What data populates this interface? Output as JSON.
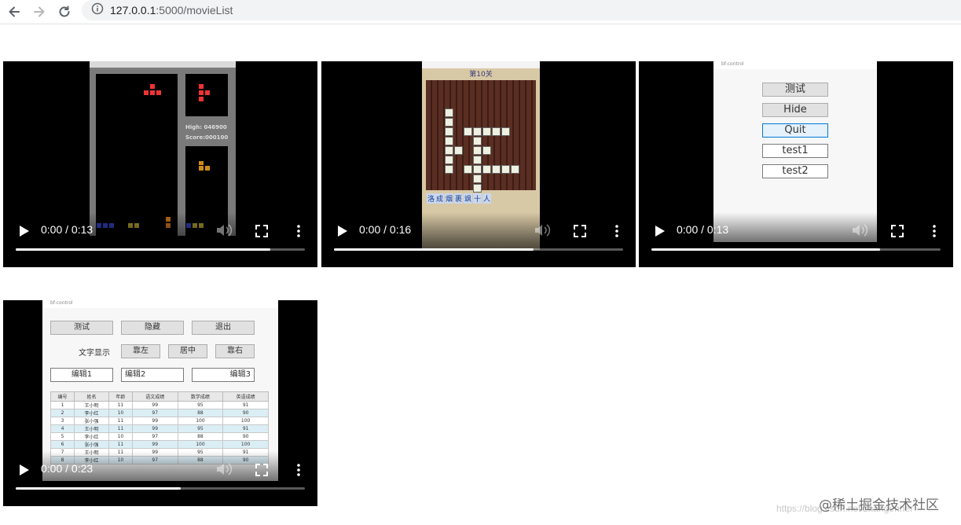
{
  "browser": {
    "url_host": "127.0.0.1",
    "url_path": ":5000/movieList",
    "icons": [
      "back-arrow-icon",
      "forward-arrow-icon",
      "reload-icon",
      "info-icon"
    ]
  },
  "videos": [
    {
      "time": "0:00 / 0:13",
      "progress": 0.88,
      "content": {
        "high": "High: 046900",
        "score": "Score:000100"
      }
    },
    {
      "time": "0:00 / 0:16",
      "progress": 0.69,
      "content": {
        "level": "第10关",
        "options": [
          "洛",
          "成",
          "烟",
          "裹",
          "飒",
          "十",
          "人"
        ]
      }
    },
    {
      "time": "0:00 / 0:13",
      "progress": 0.79,
      "content": {
        "window_title": "bf-control",
        "buttons": [
          "测试",
          "Hide",
          "Quit"
        ],
        "edits": [
          "test1",
          "test2"
        ]
      }
    },
    {
      "time": "0:00 / 0:23",
      "progress": 0.57,
      "content": {
        "window_title": "bf-control",
        "top_buttons": [
          "测试",
          "隐藏",
          "退出"
        ],
        "text_label": "文字显示",
        "align_buttons": [
          "靠左",
          "居中",
          "靠右"
        ],
        "edits": [
          "编辑1",
          "编辑2",
          "编辑3"
        ],
        "table_headers": [
          "编号",
          "姓名",
          "年龄",
          "语文成绩",
          "数学成绩",
          "英语成绩"
        ],
        "table_rows": [
          [
            "1",
            "王小明",
            "11",
            "99",
            "95",
            "91"
          ],
          [
            "2",
            "李小红",
            "10",
            "97",
            "88",
            "90"
          ],
          [
            "3",
            "张小强",
            "11",
            "99",
            "100",
            "100"
          ],
          [
            "4",
            "王小明",
            "11",
            "99",
            "95",
            "91"
          ],
          [
            "5",
            "李小红",
            "10",
            "97",
            "88",
            "90"
          ],
          [
            "6",
            "张小强",
            "11",
            "99",
            "100",
            "100"
          ],
          [
            "7",
            "王小明",
            "11",
            "99",
            "95",
            "91"
          ],
          [
            "8",
            "李小红",
            "10",
            "97",
            "88",
            "90"
          ]
        ]
      }
    }
  ],
  "watermark": "@稀土掘金技术社区",
  "watermark_faint": "https://blog.csdn.net/zhangenher"
}
